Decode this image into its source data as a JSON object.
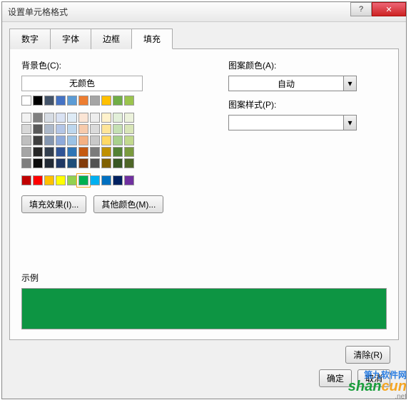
{
  "title": "设置单元格格式",
  "tabs": [
    "数字",
    "字体",
    "边框",
    "填充"
  ],
  "active_tab": 3,
  "bg_color_label": "背景色(C):",
  "no_color_label": "无颜色",
  "fill_effect_btn": "填充效果(I)...",
  "other_color_btn": "其他颜色(M)...",
  "pattern_color_label": "图案颜色(A):",
  "pattern_color_value": "自动",
  "pattern_style_label": "图案样式(P):",
  "sample_label": "示例",
  "sample_color": "#0d9543",
  "clear_btn": "清除(R)",
  "ok_btn": "确定",
  "cancel_btn": "取消",
  "palette_row1": [
    "#ffffff",
    "#000000",
    "#44546a",
    "#4472c4",
    "#5b9bd5",
    "#ed7d31",
    "#a5a5a5",
    "#ffc000",
    "#70ad47",
    "#9bc44d"
  ],
  "palette_block": [
    [
      "#f2f2f2",
      "#7f7f7f",
      "#d6dce4",
      "#d9e2f3",
      "#deebf6",
      "#fbe5d5",
      "#ededed",
      "#fff2cc",
      "#e2efd9",
      "#ecf2dc"
    ],
    [
      "#d8d8d8",
      "#595959",
      "#adb9ca",
      "#b4c6e7",
      "#bdd7ee",
      "#f7cbac",
      "#dbdbdb",
      "#fee599",
      "#c5e0b3",
      "#d9e6b8"
    ],
    [
      "#bfbfbf",
      "#3f3f3f",
      "#8496b0",
      "#8eaadb",
      "#9cc3e5",
      "#f4b183",
      "#c9c9c9",
      "#ffd965",
      "#a8d08d",
      "#c2d98e"
    ],
    [
      "#a5a5a5",
      "#262626",
      "#333f4f",
      "#2f5496",
      "#2e75b5",
      "#c55a11",
      "#7b7b7b",
      "#bf9000",
      "#538135",
      "#7a9a3e"
    ],
    [
      "#7f7f7f",
      "#0c0c0c",
      "#222a35",
      "#1f3864",
      "#1e4e79",
      "#833c0b",
      "#525252",
      "#7f6000",
      "#375623",
      "#4e6627"
    ]
  ],
  "palette_std": [
    "#c00000",
    "#ff0000",
    "#ffc000",
    "#ffff00",
    "#92d050",
    "#00b050",
    "#00b0f0",
    "#0070c0",
    "#002060",
    "#7030a0"
  ],
  "selected_color": "#00b050",
  "watermark": {
    "line1": "第九软件网",
    "line2a": "shan",
    "line2b": "cun",
    "line3": ".net"
  }
}
